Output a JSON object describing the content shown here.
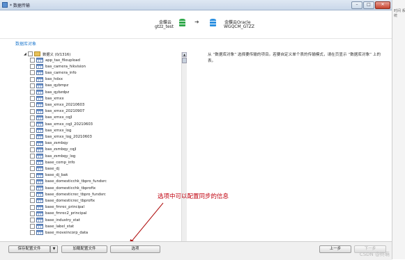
{
  "window": {
    "title": "* 数据传输",
    "controls": [
      "–",
      "□",
      "✕"
    ]
  },
  "right_strip_text": "时间 系统",
  "header": {
    "source_name": "金蝶云",
    "source_db": "gtzz_test",
    "target_name": "金蝶云Oracle",
    "target_db": "WGQCM_GTZZ"
  },
  "section_title": "数据库对象",
  "tree": {
    "root": {
      "label": "数据义 (0/1316)",
      "expander": "◢"
    },
    "items": [
      "app_tax_fileupload",
      "bas_camera_hikvision",
      "bas_camera_info",
      "bas_hdxx",
      "bas_qybmpz",
      "bas_qybzdpz",
      "bas_xmxx",
      "bas_xmxx_20210603",
      "bas_xmxx_20210907",
      "bas_xmxx_cqjl",
      "bas_xmxx_cqjl_20210603",
      "bas_xmxx_log",
      "bas_xmxx_log_20210603",
      "bas_zsmbqy",
      "bas_zsmbqy_cqjl",
      "bas_zsmbqy_log",
      "base_comp_info",
      "base_dj",
      "base_dj_bak",
      "base_domesticchk_tbpro_fundsrc",
      "base_domesticchk_tbprofix",
      "base_domesticrec_tbpro_fundsrc",
      "base_domesticrec_tbprofix",
      "base_fmrec_principal",
      "base_fmrec2_principal",
      "base_industry_stat",
      "base_label_stat",
      "base_moveincorp_data"
    ]
  },
  "description": "从 “数据库对象” 选择要传输的项目。若要自定义单个表的传输模式，请在页显示 “数据库对象” 上的表。",
  "annotation": "选项中可以配置同步的信息",
  "footer": {
    "save_config": "保存配置文件",
    "dropdown_arrow": "▼",
    "load_config": "加载配置文件",
    "options": "选项",
    "prev": "上一步",
    "next": "下一步"
  },
  "watermark": "CSDN @终萌",
  "colors": {
    "accent_blue": "#2a7fd0",
    "annotation_red": "#c0000e",
    "db_source_green": "#2fa84a",
    "db_target_blue": "#2a8fe0"
  },
  "icons": {
    "source_db": "database-icon",
    "target_db": "database-icon",
    "transfer_arrow": "arrow-right-icon",
    "table": "table-icon",
    "folder": "folder-icon"
  }
}
